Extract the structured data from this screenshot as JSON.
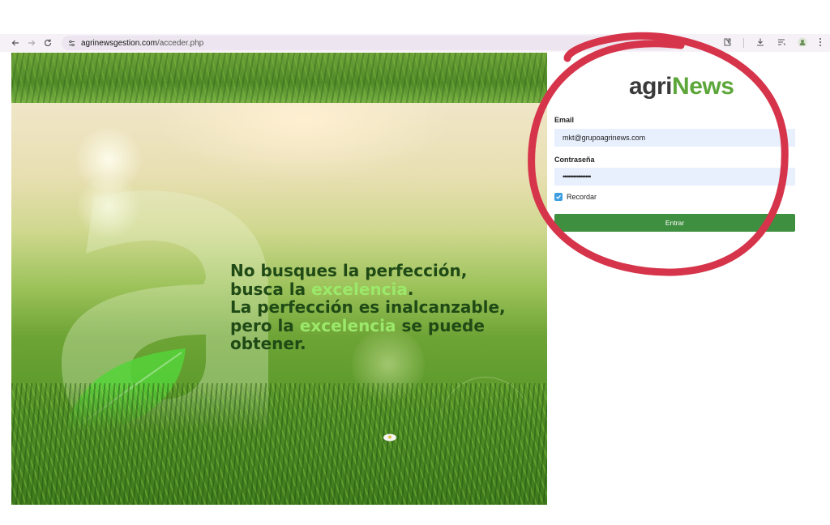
{
  "browser": {
    "url_host": "agrinewsgestion.com",
    "url_path": "/acceder.php"
  },
  "hero": {
    "quote_line1": "No busques la perfección,",
    "quote_line2_a": "busca la ",
    "quote_line2_highlight": "excelencia",
    "quote_line2_b": ".",
    "quote_line3": "La perfección es inalcanzable,",
    "quote_line4_a": "pero la ",
    "quote_line4_highlight": "excelencia",
    "quote_line4_b": " se puede",
    "quote_line5": "obtener."
  },
  "login": {
    "logo_agri": "agri",
    "logo_news": "News",
    "email_label": "Email",
    "email_value": "mkt@grupoagrinews.com",
    "password_label": "Contraseña",
    "password_value": "••••••••••••••••",
    "remember_label": "Recordar",
    "remember_checked": true,
    "submit_label": "Entrar"
  },
  "colors": {
    "brand_green": "#5da63a",
    "button_green": "#3f8f41",
    "annotation_red": "#d6344a",
    "field_bg": "#e8effd"
  }
}
